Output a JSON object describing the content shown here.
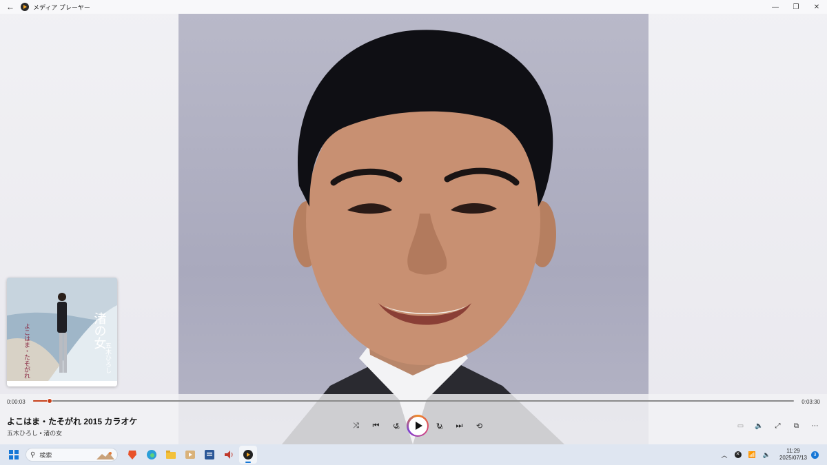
{
  "window": {
    "title": "メディア プレーヤー"
  },
  "player": {
    "elapsed": "0:00:03",
    "total": "0:03:30",
    "progress_fraction": 0.022,
    "song_title": "よこはま・たそがれ 2015 カラオケ",
    "artist_album": "五木ひろし • 渚の女",
    "skip_back_seconds": "10",
    "skip_forward_seconds": "30"
  },
  "album_art": {
    "title_text": "渚の女",
    "artist_text": "五木ひろし",
    "song_text": "よこはま・たそがれ"
  },
  "taskbar": {
    "search_placeholder": "検索",
    "time": "11:29",
    "date": "2025/07/13",
    "notification_count": "3"
  },
  "colors": {
    "accent": "#c8401a",
    "taskbar": "#dfe6f1",
    "windows_blue": "#1677d6"
  }
}
